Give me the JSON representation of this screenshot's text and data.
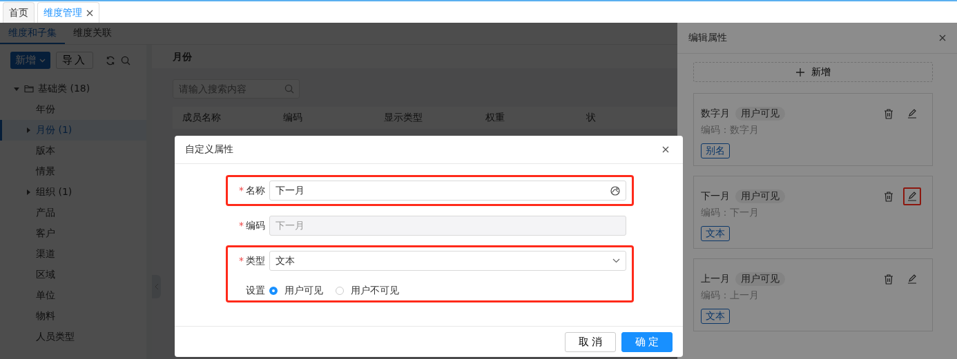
{
  "tabs": [
    {
      "label": "首页",
      "selected": false,
      "closable": false
    },
    {
      "label": "维度管理",
      "selected": true,
      "closable": true
    }
  ],
  "subtabs": [
    {
      "label": "维度和子集",
      "selected": true
    },
    {
      "label": "维度关联",
      "selected": false
    }
  ],
  "toolbar": {
    "new_button": "新增",
    "import_button": "导入"
  },
  "tree": [
    {
      "label": "基础类 (18)",
      "folder": true,
      "expandable": true,
      "expanded": true,
      "selected": false,
      "children": [
        {
          "label": "年份",
          "expandable": false,
          "selected": false
        },
        {
          "label": "月份 (1)",
          "expandable": true,
          "expanded": false,
          "selected": true
        },
        {
          "label": "版本",
          "expandable": false,
          "selected": false
        },
        {
          "label": "情景",
          "expandable": false,
          "selected": false
        },
        {
          "label": "组织 (1)",
          "expandable": true,
          "expanded": false,
          "selected": false
        },
        {
          "label": "产品",
          "expandable": false,
          "selected": false
        },
        {
          "label": "客户",
          "expandable": false,
          "selected": false
        },
        {
          "label": "渠道",
          "expandable": false,
          "selected": false
        },
        {
          "label": "区域",
          "expandable": false,
          "selected": false
        },
        {
          "label": "单位",
          "expandable": false,
          "selected": false
        },
        {
          "label": "物料",
          "expandable": false,
          "selected": false
        },
        {
          "label": "人员类型",
          "expandable": false,
          "selected": false
        }
      ]
    }
  ],
  "content": {
    "title": "月份",
    "search": {
      "placeholder": "请输入搜索内容"
    },
    "columns": [
      "成员名称",
      "编码",
      "显示类型",
      "权重",
      "状"
    ]
  },
  "drawer": {
    "title": "编辑属性",
    "add_button": "新增",
    "cards": [
      {
        "name": "数字月",
        "visibility": "用户可见",
        "code": "编码：数字月",
        "tag": "别名",
        "edit_highlighted": false
      },
      {
        "name": "下一月",
        "visibility": "用户可见",
        "code": "编码：下一月",
        "tag": "文本",
        "edit_highlighted": true
      },
      {
        "name": "上一月",
        "visibility": "用户可见",
        "code": "编码：上一月",
        "tag": "文本",
        "edit_highlighted": false
      }
    ]
  },
  "dialog": {
    "title": "自定义属性",
    "groups": [
      {
        "highlighted": true,
        "fields": [
          {
            "kind": "text",
            "label": "名称",
            "required_mark": "*",
            "value": "下一月",
            "disabled": false
          }
        ]
      },
      {
        "highlighted": false,
        "fields": [
          {
            "kind": "text",
            "label": "编码",
            "required_mark": "*",
            "value": "下一月",
            "disabled": true
          }
        ]
      },
      {
        "highlighted": true,
        "fields": [
          {
            "kind": "select",
            "label": "类型",
            "required_mark": "*",
            "value": "文本"
          },
          {
            "kind": "radio",
            "label": "设置",
            "options": [
              {
                "label": "用户可见",
                "selected": true
              },
              {
                "label": "用户不可见",
                "selected": false
              }
            ]
          }
        ]
      }
    ],
    "buttons": [
      {
        "label": "取 消",
        "kind": "default"
      },
      {
        "label": "确 定",
        "kind": "primary"
      }
    ]
  }
}
